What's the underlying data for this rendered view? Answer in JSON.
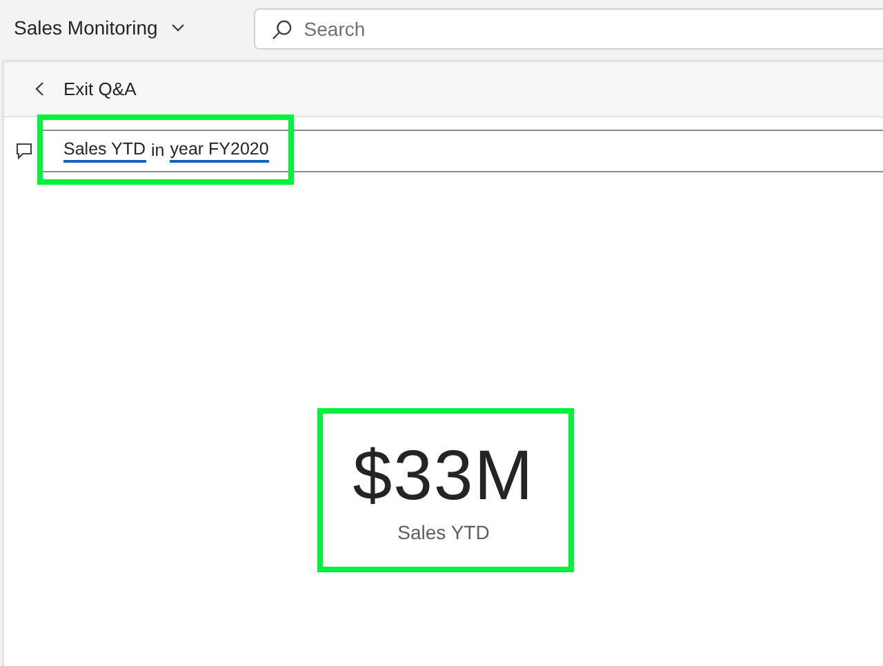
{
  "app_bar": {
    "title": "Sales Monitoring",
    "search": {
      "placeholder": "Search"
    }
  },
  "qa": {
    "exit_label": "Exit Q&A",
    "question": [
      {
        "text": "Sales YTD",
        "recognized": true
      },
      {
        "text": "in",
        "recognized": false
      },
      {
        "text": "year FY2020",
        "recognized": true
      }
    ]
  },
  "card": {
    "value": "$33M",
    "label": "Sales YTD"
  }
}
